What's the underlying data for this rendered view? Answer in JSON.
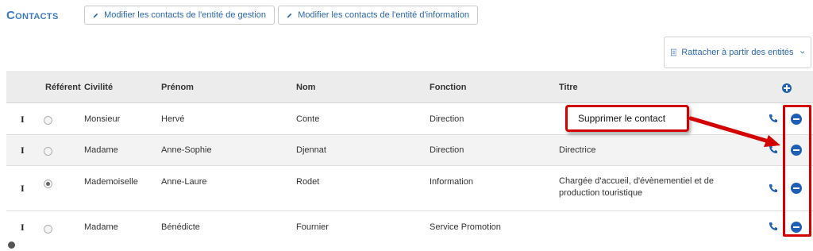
{
  "section": {
    "title": "Contacts"
  },
  "toolbar": {
    "edit_gestion_label": "Modifier les contacts de l'entité de gestion",
    "edit_info_label": "Modifier les contacts de l'entité d'information",
    "attach_label": "Rattacher à partir des entités"
  },
  "table": {
    "headers": {
      "referent": "Référent",
      "civilite": "Civilité",
      "prenom": "Prénom",
      "nom": "Nom",
      "fonction": "Fonction",
      "titre": "Titre"
    },
    "rows": [
      {
        "drag": "I",
        "referent_checked": false,
        "civilite": "Monsieur",
        "prenom": "Hervé",
        "nom": "Conte",
        "fonction": "Direction",
        "titre": ""
      },
      {
        "drag": "I",
        "referent_checked": false,
        "civilite": "Madame",
        "prenom": "Anne-Sophie",
        "nom": "Djennat",
        "fonction": "Direction",
        "titre": "Directrice"
      },
      {
        "drag": "I",
        "referent_checked": true,
        "civilite": "Mademoiselle",
        "prenom": "Anne-Laure",
        "nom": "Rodet",
        "fonction": "Information",
        "titre": "Chargée d'accueil, d'évènementiel et de production touristique"
      },
      {
        "drag": "I",
        "referent_checked": false,
        "civilite": "Madame",
        "prenom": "Bénédicte",
        "nom": "Fournier",
        "fonction": "Service Promotion",
        "titre": ""
      }
    ]
  },
  "annotation": {
    "callout_text": "Supprimer le contact",
    "color": "#d40000"
  },
  "colors": {
    "accent": "#3a7bc8",
    "action_blue": "#1f5fb5",
    "header_bg": "#ececec"
  },
  "icons": {
    "edit": "pencil-icon",
    "attach": "list-icon",
    "phone": "phone-icon",
    "remove": "minus-circle-icon",
    "add": "plus-circle-icon"
  }
}
